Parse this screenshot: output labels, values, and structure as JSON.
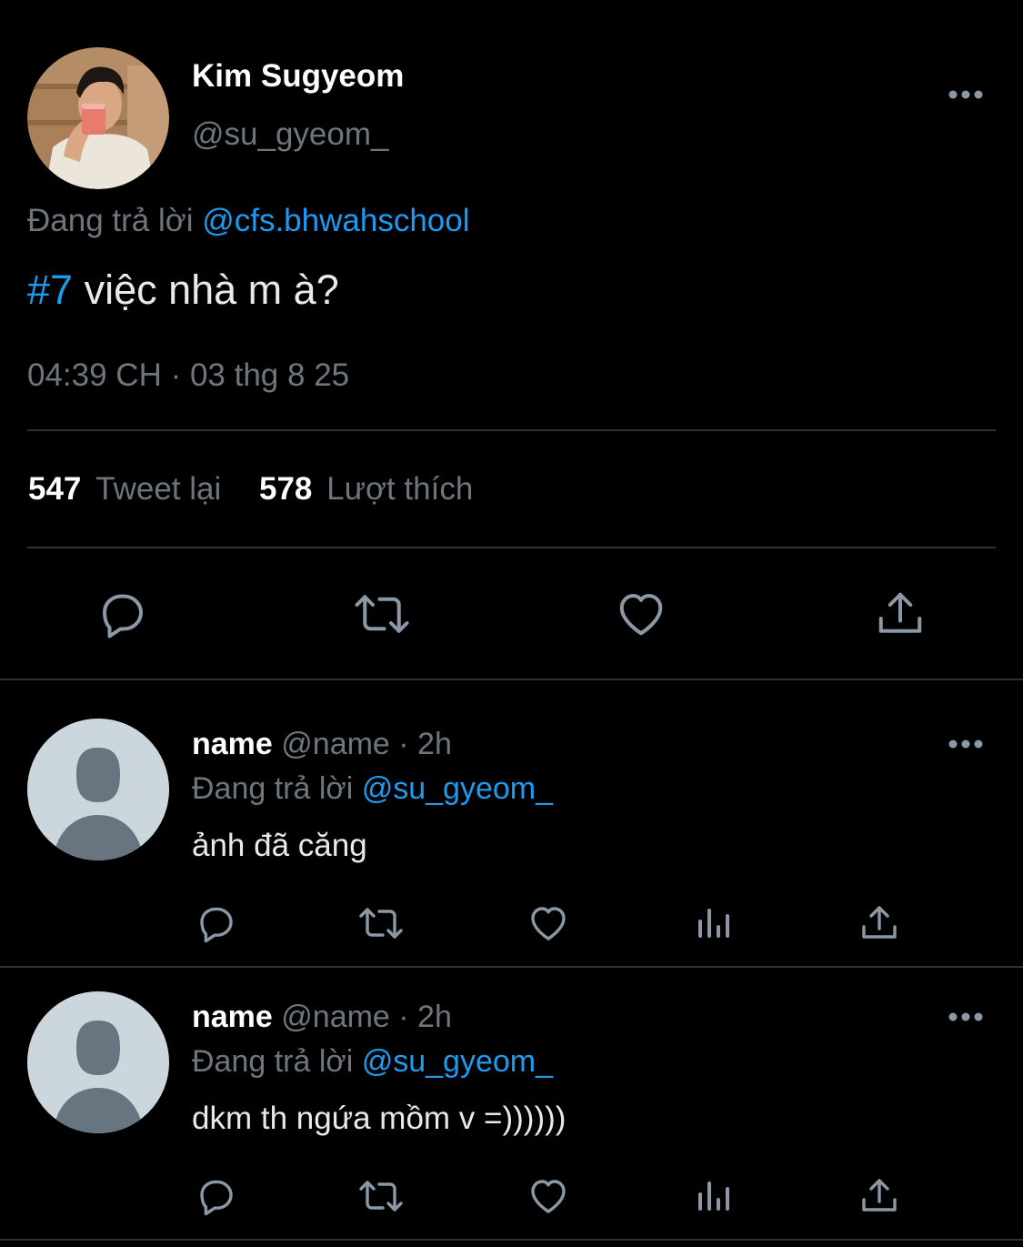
{
  "main_tweet": {
    "display_name": "Kim Sugyeom",
    "handle": "@su_gyeom_",
    "replying_prefix": "Đang trả lời",
    "replying_to": "@cfs.bhwahschool",
    "text_hashtag": "#7",
    "text_body": " việc nhà m à?",
    "timestamp": "04:39 CH · 03 thg 8 25",
    "retweets_count": "547",
    "retweets_label": "Tweet lại",
    "likes_count": "578",
    "likes_label": "Lượt thích"
  },
  "replies": [
    {
      "name": "name",
      "meta": " @name · 2h",
      "replying_prefix": "Đang trả lời",
      "replying_to": "@su_gyeom_",
      "text": "ảnh đã căng"
    },
    {
      "name": "name",
      "meta": " @name · 2h",
      "replying_prefix": "Đang trả lời",
      "replying_to": "@su_gyeom_",
      "text": "dkm th ngứa mồm v =))))))"
    }
  ],
  "icons": {
    "reply": "reply-icon",
    "retweet": "retweet-icon",
    "like": "heart-icon",
    "share": "share-icon",
    "analytics": "analytics-icon",
    "more": "more-icon"
  },
  "colors": {
    "background": "#000000",
    "link": "#1d9bf0",
    "secondary_text": "#6e767d",
    "divider": "#2f3336",
    "icon": "#8b98a5"
  }
}
